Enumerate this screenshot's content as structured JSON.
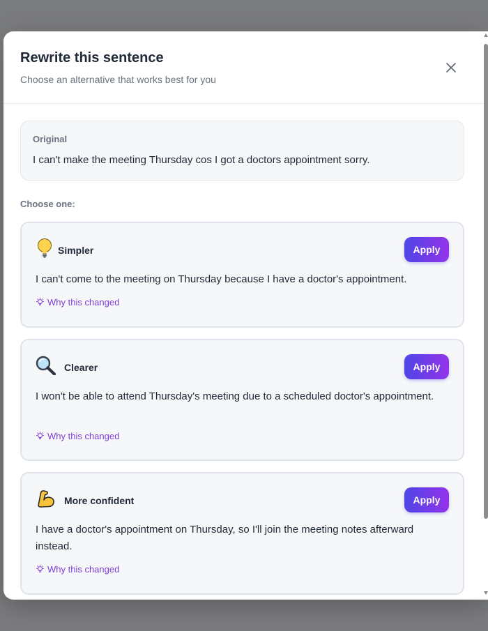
{
  "dialog": {
    "title": "Rewrite this sentence",
    "subtitle": "Choose an alternative that works best for you"
  },
  "original": {
    "label": "Original",
    "text": "I can't make the meeting Thursday cos I got a doctors appointment sorry."
  },
  "choose_label": "Choose one:",
  "options": [
    {
      "icon": "lightbulb-icon",
      "name": "Simpler",
      "text": "I can't come to the meeting on Thursday because I have a doctor's appointment.",
      "apply_label": "Apply",
      "why_label": "Why this changed"
    },
    {
      "icon": "magnifying-glass-icon",
      "name": "Clearer",
      "text": "I won't be able to attend Thursday's meeting due to a scheduled doctor's appointment.",
      "apply_label": "Apply",
      "why_label": "Why this changed"
    },
    {
      "icon": "flexed-biceps-icon",
      "name": "More confident",
      "text": "I have a doctor's appointment on Thursday, so I'll join the meeting notes afterward instead.",
      "apply_label": "Apply",
      "why_label": "Why this changed"
    }
  ],
  "colors": {
    "accent_start": "#4f46e5",
    "accent_end": "#9333ea",
    "link": "#7e3fd6"
  }
}
